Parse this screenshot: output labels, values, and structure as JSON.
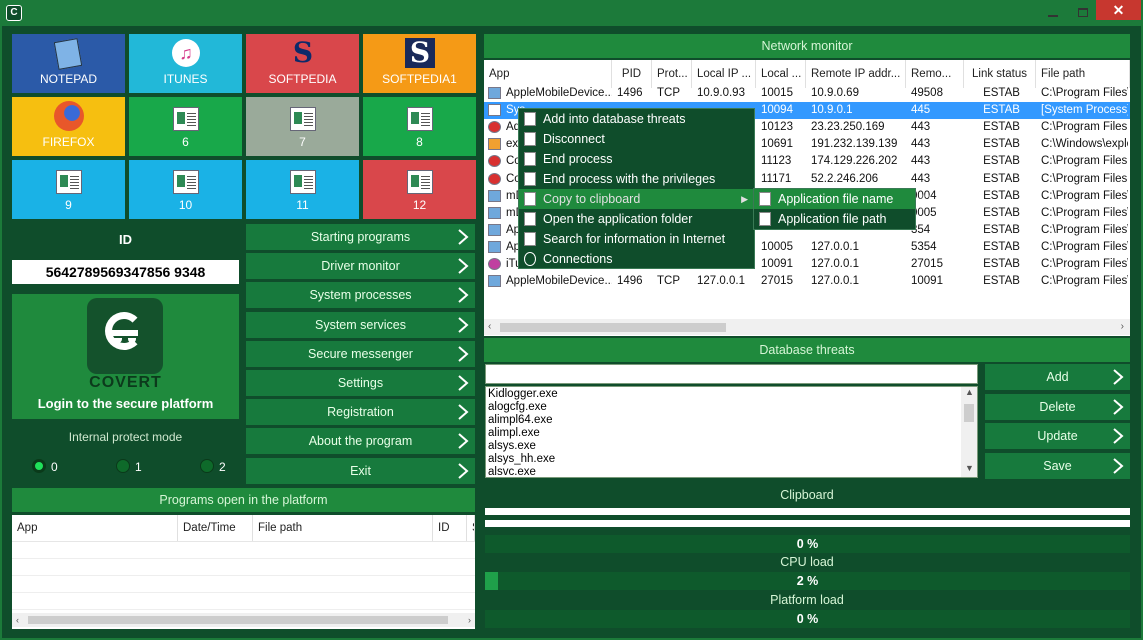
{
  "window": {
    "logo": "covert-app-icon",
    "minimize": "minimize-icon",
    "maximize": "maximize-icon",
    "close": "close-icon"
  },
  "tiles": [
    {
      "label": "NOTEPAD",
      "color": "#2b5aa8",
      "icon": "notepad-icon"
    },
    {
      "label": "ITUNES",
      "color": "#22b8d8",
      "icon": "itunes-icon"
    },
    {
      "label": "SOFTPEDIA",
      "color": "#d9474b",
      "icon": "softpedia-icon"
    },
    {
      "label": "SOFTPEDIA1",
      "color": "#f59a16",
      "icon": "softpedia-icon"
    },
    {
      "label": "FIREFOX",
      "color": "#f6bf10",
      "icon": "firefox-icon"
    },
    {
      "label": "6",
      "color": "#18a84a",
      "icon": "app-window-icon"
    },
    {
      "label": "7",
      "color": "#9aaa9a",
      "icon": "app-window-icon"
    },
    {
      "label": "8",
      "color": "#18a84a",
      "icon": "app-window-icon"
    },
    {
      "label": "9",
      "color": "#1ab2e6",
      "icon": "app-window-icon"
    },
    {
      "label": "10",
      "color": "#1ab2e6",
      "icon": "app-window-icon"
    },
    {
      "label": "11",
      "color": "#1ab2e6",
      "icon": "app-window-icon"
    },
    {
      "label": "12",
      "color": "#d9474b",
      "icon": "app-window-icon"
    }
  ],
  "id_label": "ID",
  "id_value": "5642789569347856 9348",
  "brand": {
    "name": "COVERT",
    "login": "Login to the secure platform"
  },
  "protect": {
    "label": "Internal protect mode",
    "options": [
      "0",
      "1",
      "2"
    ],
    "selected": "0"
  },
  "menu": [
    "Starting programs",
    "Driver monitor",
    "System processes",
    "System services",
    "Secure messenger",
    "Settings",
    "Registration",
    "About the program",
    "Exit"
  ],
  "programs_panel": {
    "title": "Programs open in the platform",
    "columns": [
      "App",
      "Date/Time",
      "File path",
      "ID",
      "S"
    ]
  },
  "network": {
    "title": "Network monitor",
    "columns": [
      "App",
      "PID",
      "Prot...",
      "Local IP ...",
      "Local ...",
      "Remote IP addr...",
      "Remo...",
      "Link status",
      "File path"
    ],
    "rows": [
      [
        "AppleMobileDevice...",
        "1496",
        "TCP",
        "10.9.0.93",
        "10015",
        "10.9.0.69",
        "49508",
        "ESTAB",
        "C:\\Program Files\\C"
      ],
      [
        "Sys",
        "",
        "",
        "",
        "10094",
        "10.9.0.1",
        "445",
        "ESTAB",
        "[System Process]"
      ],
      [
        "Ad",
        "",
        "",
        "",
        "10123",
        "23.23.250.169",
        "443",
        "ESTAB",
        "C:\\Program Files (x"
      ],
      [
        "ex",
        "",
        "",
        "",
        "10691",
        "191.232.139.139",
        "443",
        "ESTAB",
        "C:\\Windows\\explo"
      ],
      [
        "Co",
        "",
        "",
        "",
        "11123",
        "174.129.226.202",
        "443",
        "ESTAB",
        "C:\\Program Files (x"
      ],
      [
        "Co",
        "",
        "",
        "",
        "11171",
        "52.2.246.206",
        "443",
        "ESTAB",
        "C:\\Program Files (x"
      ],
      [
        "mD",
        "",
        "",
        "",
        "",
        "",
        "0004",
        "ESTAB",
        "C:\\Program Files\\B"
      ],
      [
        "mD",
        "",
        "",
        "",
        "",
        "",
        "0005",
        "ESTAB",
        "C:\\Program Files\\B"
      ],
      [
        "Ap",
        "",
        "",
        "",
        "",
        "",
        "354",
        "ESTAB",
        "C:\\Program Files\\C"
      ],
      [
        "Ap",
        "",
        "",
        "",
        "10005",
        "127.0.0.1",
        "5354",
        "ESTAB",
        "C:\\Program Files\\C"
      ],
      [
        "iTu",
        "",
        "",
        "",
        "10091",
        "127.0.0.1",
        "27015",
        "ESTAB",
        "C:\\Program Files\\i"
      ],
      [
        "AppleMobileDevice...",
        "1496",
        "TCP",
        "127.0.0.1",
        "27015",
        "127.0.0.1",
        "10091",
        "ESTAB",
        "C:\\Program Files\\C"
      ]
    ]
  },
  "context_menu": {
    "items": [
      "Add into database threats",
      "Disconnect",
      "End process",
      "End process with the privileges",
      "Copy to clipboard",
      "Open the application folder",
      "Search for information in Internet",
      "Connections"
    ],
    "submenu": [
      "Application file name",
      "Application file path"
    ]
  },
  "db": {
    "title": "Database threats",
    "search_value": "",
    "items": [
      "Kidlogger.exe",
      "alogcfg.exe",
      "alimpl64.exe",
      "alimpl.exe",
      "alsys.exe",
      "alsys_hh.exe",
      "alsvc.exe"
    ],
    "buttons": [
      "Add",
      "Delete",
      "Update",
      "Save"
    ]
  },
  "clipboard": {
    "title": "Clipboard"
  },
  "stats": {
    "clipboard_pct": "0 %",
    "cpu_label": "CPU load",
    "cpu_pct": "2 %",
    "cpu_fill": 0.02,
    "platform_label": "Platform load",
    "platform_pct": "0 %"
  },
  "colors": {
    "accent": "#1f8a3d",
    "dark": "#0f4d2b",
    "selection": "#3399ff"
  }
}
